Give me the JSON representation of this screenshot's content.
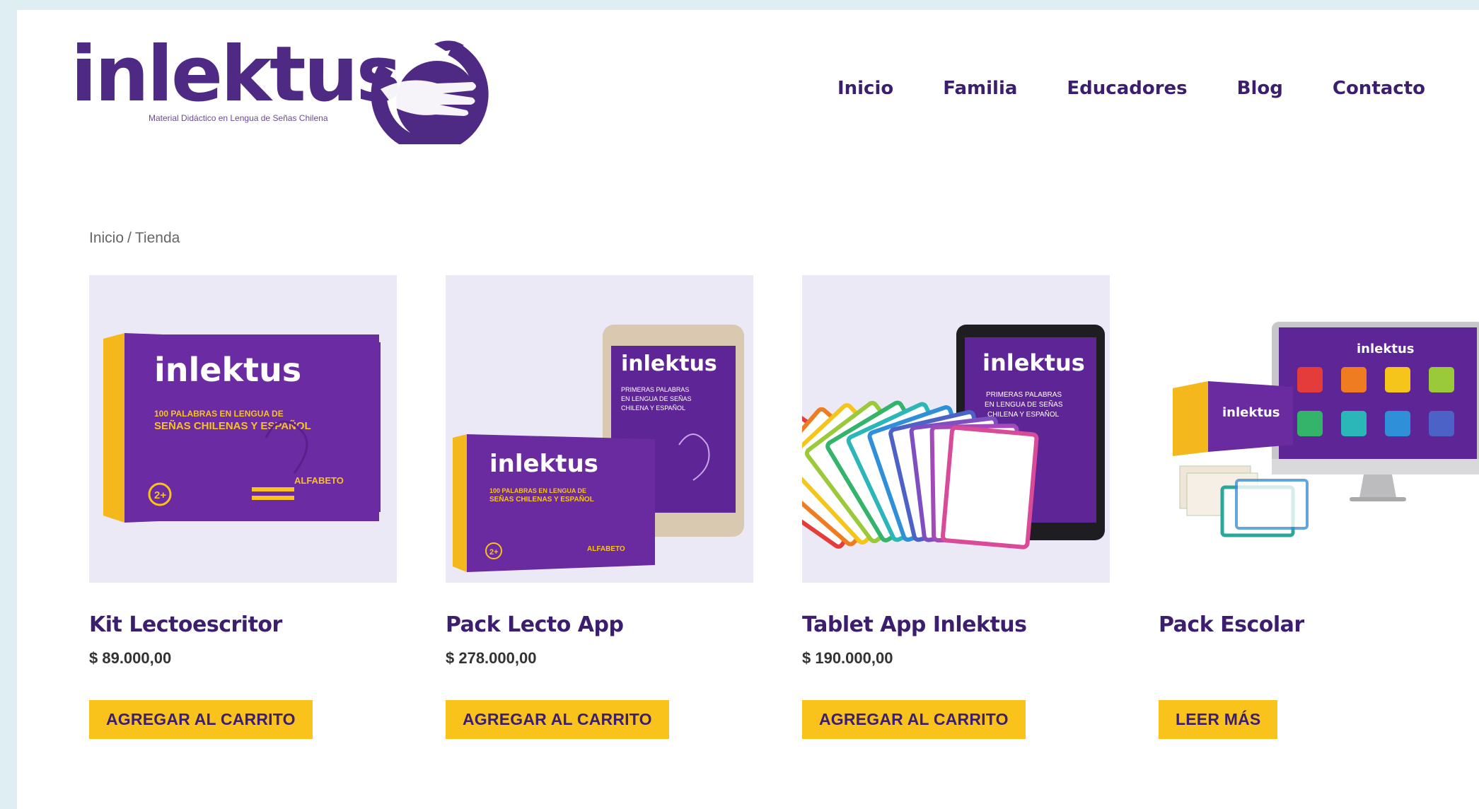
{
  "header": {
    "logo_text": "inlektus",
    "logo_tagline": "Material Didáctico en Lengua de Señas Chilena",
    "nav": [
      "Inicio",
      "Familia",
      "Educadores",
      "Blog",
      "Contacto"
    ]
  },
  "breadcrumb": {
    "home": "Inicio",
    "separator": "/",
    "current": "Tienda"
  },
  "products": [
    {
      "name": "Kit Lectoescritor",
      "price": "$ 89.000,00",
      "button": "AGREGAR AL CARRITO",
      "box_brand": "inlektus",
      "box_subtitle": "100 PALABRAS EN LENGUA DE SEÑAS CHILENAS Y ESPAÑOL",
      "box_badge": "2+",
      "box_corner": "ALFABETO"
    },
    {
      "name": "Pack Lecto App",
      "price": "$ 278.000,00",
      "button": "AGREGAR AL CARRITO",
      "box_brand": "inlektus",
      "box_subtitle": "100 PALABRAS EN LENGUA DE SEÑAS CHILENAS Y ESPAÑOL",
      "box_badge": "2+",
      "box_corner": "ALFABETO",
      "tablet_brand": "inlektus",
      "tablet_text": "PRIMERAS PALABRAS EN LENGUA DE SEÑAS CHILENA Y ESPAÑOL"
    },
    {
      "name": "Tablet App Inlektus",
      "price": "$ 190.000,00",
      "button": "AGREGAR AL CARRITO",
      "tablet_brand": "inlektus",
      "tablet_text": "PRIMERAS PALABRAS EN LENGUA DE SEÑAS CHILENA Y ESPAÑOL"
    },
    {
      "name": "Pack Escolar",
      "price": "",
      "button": "LEER MÁS",
      "box_brand": "inlektus",
      "screen_brand": "inlektus"
    }
  ],
  "colors": {
    "brand_purple": "#4e2a84",
    "nav_text": "#3b1e6e",
    "button_yellow": "#f9c31c",
    "thumb_bg": "#ebe9f6",
    "page_frame": "#dfeef3"
  },
  "card_swatches": [
    "#e43b3b",
    "#f07c22",
    "#f5c51b",
    "#9ac93a",
    "#34b36b",
    "#2bb7b8",
    "#2f8fd8",
    "#4d62c7",
    "#7f4fc1",
    "#a34ab8",
    "#d94a98"
  ]
}
